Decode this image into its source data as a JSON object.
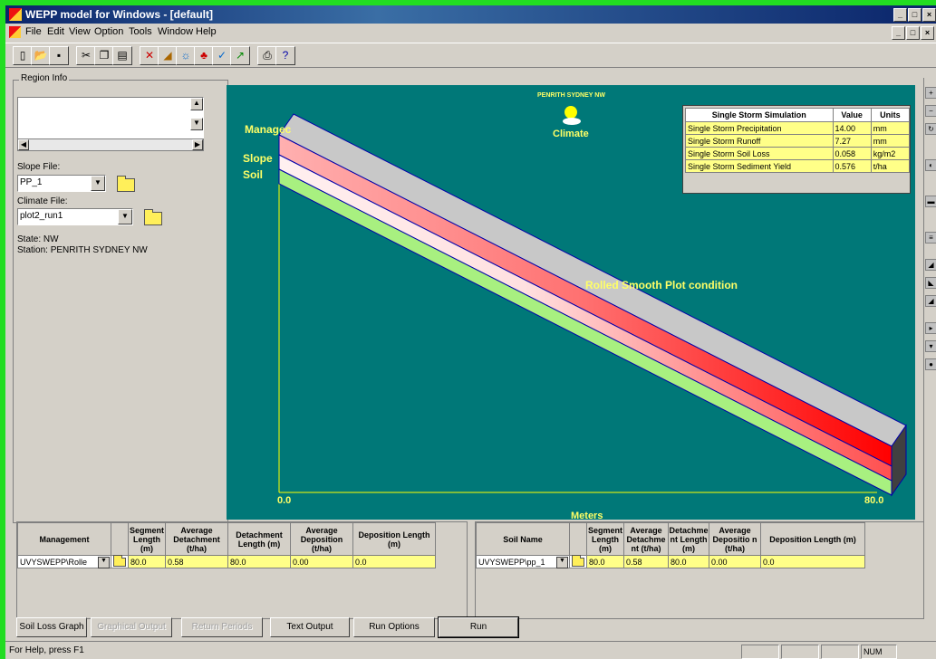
{
  "window": {
    "title": "WEPP model  for Windows - [default]"
  },
  "menu": [
    "File",
    "Edit",
    "View",
    "Option",
    "Tools",
    "Window",
    "Help"
  ],
  "region": {
    "label": "Region Info",
    "slope_label": "Slope File:",
    "slope_value": "PP_1",
    "climate_label": "Climate File:",
    "climate_value": "plot2_run1",
    "state_text": "State: NW",
    "station_text": "Station: PENRITH SYDNEY NW"
  },
  "plot": {
    "layer_labels": [
      "Managec",
      "Slope",
      "Soil"
    ],
    "climate_station": "PENRITH SYDNEY NW",
    "climate_label": "Climate",
    "condition": "Rolled Smooth Plot condition",
    "x_start": "0.0",
    "x_end": "80.0",
    "x_axis_label": "Meters"
  },
  "storm": {
    "headers": [
      "Single Storm Simulation",
      "Value",
      "Units"
    ],
    "rows": [
      {
        "name": "Single Storm Precipitation",
        "value": "14.00",
        "units": "mm"
      },
      {
        "name": "Single Storm Runoff",
        "value": "7.27",
        "units": "mm"
      },
      {
        "name": "Single Storm Soil Loss",
        "value": "0.058",
        "units": "kg/m2"
      },
      {
        "name": "Single Storm Sediment Yield",
        "value": "0.576",
        "units": "t/ha"
      }
    ]
  },
  "mgmt_table": {
    "headers": [
      "Management",
      "",
      "Segment Length (m)",
      "Average Detachment (t/ha)",
      "Detachment Length (m)",
      "Average Deposition (t/ha)",
      "Deposition Length (m)"
    ],
    "row": {
      "name": "UVYSWEPP\\Rolle",
      "seg": "80.0",
      "avg_det": "0.58",
      "det_len": "80.0",
      "avg_dep": "0.00",
      "dep_len": "0.0"
    }
  },
  "soil_table": {
    "headers": [
      "Soil Name",
      "",
      "Segment Length (m)",
      "Average Detachme nt (t/ha)",
      "Detachme nt Length (m)",
      "Average Depositio n (t/ha)",
      "Deposition Length (m)"
    ],
    "row": {
      "name": "UVYSWEPP\\pp_1",
      "seg": "80.0",
      "avg_det": "0.58",
      "det_len": "80.0",
      "avg_dep": "0.00",
      "dep_len": "0.0"
    }
  },
  "buttons": {
    "soil_loss_graph": "Soil Loss Graph",
    "graphical_output": "Graphical Output",
    "return_periods": "Return Periods",
    "text_output": "Text Output",
    "run_options": "Run Options",
    "run": "Run"
  },
  "status": {
    "help": "For Help, press F1",
    "num": "NUM"
  },
  "colors": {
    "plot_bg": "#007878",
    "label_yellow": "#ffff66",
    "cell_yellow": "#ffff88",
    "title_blue": "#0a246a"
  }
}
